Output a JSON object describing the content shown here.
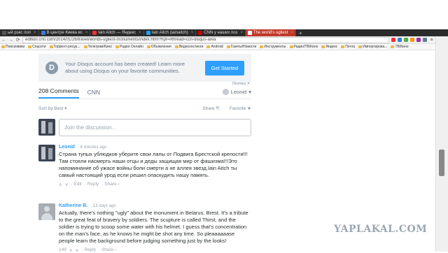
{
  "browser": {
    "tabs": [
      {
        "label": "ый рэкс пол",
        "color": "#555"
      },
      {
        "label": "В центре Киева вс",
        "color": "#3a7bd5"
      },
      {
        "label": "Iain Aitch — Яндекс",
        "color": "#e33"
      },
      {
        "label": "Iain Aitch (iainaitch)",
        "color": "#1da1f2"
      },
      {
        "label": "CNN у наших поз",
        "color": "#c00"
      },
      {
        "label": "The world's ugliest",
        "color": "#fff",
        "active": true
      }
    ],
    "new_tab": "+",
    "url": "edition.cnn.com/2014/01/26/travel/worlds-ugliest-monuments/index.html?hpt=#thread=ccn-disqus-area",
    "bookmarks": [
      "Поисковики",
      "Соцсети",
      "Торрент-ресур...",
      "Телеграм/Кино",
      "Радио Онлайн",
      "Объявления",
      "Видеохостинги",
      "Android",
      "Газеты/Новости",
      "Инструменты",
      "Радио/ТВ/Кино",
      "Яндекс",
      "Почта",
      "Импортирова...",
      "ТВ/Кино"
    ]
  },
  "banner": {
    "logo": "D",
    "text": "Your Disqus account has been created! Learn more about using Disqus on your favorite communities.",
    "button": "Get Started",
    "dismiss": "Dismiss ✕"
  },
  "header": {
    "tab_comments": "208 Comments",
    "tab_site": "CNN",
    "user": "Leonid",
    "sort": "Sort by Best ▾",
    "share": "Share",
    "favorite": "Favorite ★"
  },
  "composer": {
    "placeholder": "Join the discussion..."
  },
  "comments": [
    {
      "author": "Leonid",
      "time": "· 8 minutes ago",
      "text": "Страна тупых ублюдков уберите свои лапы от Подвига Брестской крепости!!! Там стояли насмерть наши отцы и деды защищая мир от фашизма!!!Это напоминание об ужасе войны боли смерти а не аллея звезд.Iain Aitch ты самый настоящий урод если решил опаскудить нашу память.",
      "actions": [
        "∧",
        "∨",
        "· Edit",
        "· Reply",
        "· Share ›"
      ]
    },
    {
      "author": "Katherine B.",
      "time": "· 13 days ago",
      "text": "Actually, there's nothing \"ugly\" about the monument in Belarus, Brest. It's a tribute to the great feat of bravery by soldiers. The scupture is called Thirst, and the soldier is trying to scoop some water with his helmet. I guess that's concentration on the man's face, as he knows he might be shot any time. So pleaaaaaase people learn the background before judging something just by the looks!",
      "actions": [
        "149",
        "∧",
        "∨",
        "· Reply",
        "· Share ›"
      ]
    }
  ],
  "watermark": "YAPLAKAL.COM"
}
